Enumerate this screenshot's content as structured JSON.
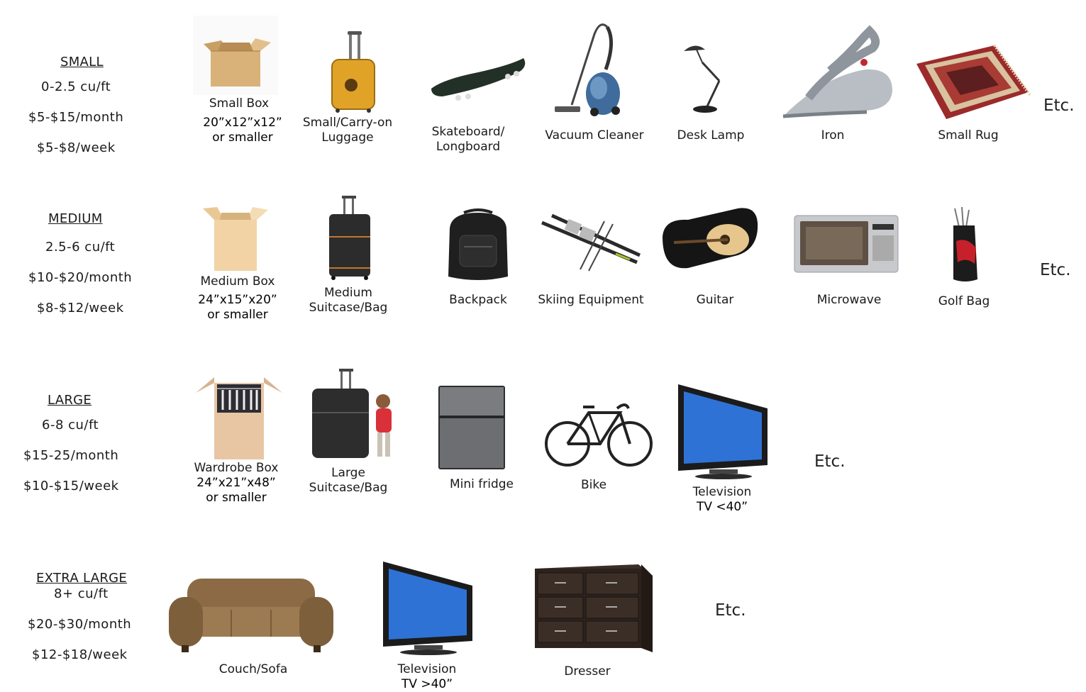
{
  "rows": [
    {
      "title": "SMALL",
      "lines": [
        "0-2.5 cu/ft",
        "$5-$15/month",
        "$5-$8/week"
      ],
      "items": [
        {
          "name": "Small Box",
          "sub": [
            "20”x12”x12”",
            "or smaller"
          ]
        },
        {
          "name": "Small/Carry-on",
          "sub": [
            "Luggage"
          ]
        },
        {
          "name": "Skateboard/",
          "sub": [
            "Longboard"
          ]
        },
        {
          "name": "Vacuum Cleaner",
          "sub": []
        },
        {
          "name": "Desk Lamp",
          "sub": []
        },
        {
          "name": "Iron",
          "sub": []
        },
        {
          "name": "Small Rug",
          "sub": []
        }
      ],
      "etc": "Etc."
    },
    {
      "title": "MEDIUM",
      "lines": [
        "2.5-6 cu/ft",
        "$10-$20/month",
        "$8-$12/week"
      ],
      "items": [
        {
          "name": "Medium Box",
          "sub": [
            "24”x15”x20”",
            "or smaller"
          ]
        },
        {
          "name": "Medium",
          "sub": [
            "Suitcase/Bag"
          ]
        },
        {
          "name": "Backpack",
          "sub": []
        },
        {
          "name": "Skiing Equipment",
          "sub": []
        },
        {
          "name": "Guitar",
          "sub": []
        },
        {
          "name": "Microwave",
          "sub": []
        },
        {
          "name": "Golf Bag",
          "sub": []
        }
      ],
      "etc": "Etc."
    },
    {
      "title": "LARGE",
      "lines": [
        "6-8 cu/ft",
        "$15-25/month",
        "$10-$15/week"
      ],
      "items": [
        {
          "name": "Wardrobe Box",
          "sub": [
            "24”x21”x48”",
            "or smaller"
          ]
        },
        {
          "name": "Large",
          "sub": [
            "Suitcase/Bag"
          ]
        },
        {
          "name": "Mini fridge",
          "sub": []
        },
        {
          "name": "Bike",
          "sub": []
        },
        {
          "name": "Television",
          "sub": [
            "TV <40”"
          ]
        }
      ],
      "etc": "Etc."
    },
    {
      "title": "EXTRA LARGE",
      "lines": [
        "8+ cu/ft",
        "$20-$30/month",
        "$12-$18/week"
      ],
      "items": [
        {
          "name": "Couch/Sofa",
          "sub": []
        },
        {
          "name": "Television",
          "sub": [
            "TV >40”"
          ]
        },
        {
          "name": "Dresser",
          "sub": []
        }
      ],
      "etc": "Etc."
    }
  ],
  "icons": [
    "cardboard-box-icon",
    "luggage-icon",
    "skateboard-icon",
    "vacuum-cleaner-icon",
    "desk-lamp-icon",
    "iron-icon",
    "rug-icon",
    "backpack-icon",
    "skis-icon",
    "guitar-icon",
    "microwave-icon",
    "golf-bag-icon",
    "wardrobe-box-icon",
    "mini-fridge-icon",
    "bike-icon",
    "television-icon",
    "couch-icon",
    "dresser-icon"
  ]
}
